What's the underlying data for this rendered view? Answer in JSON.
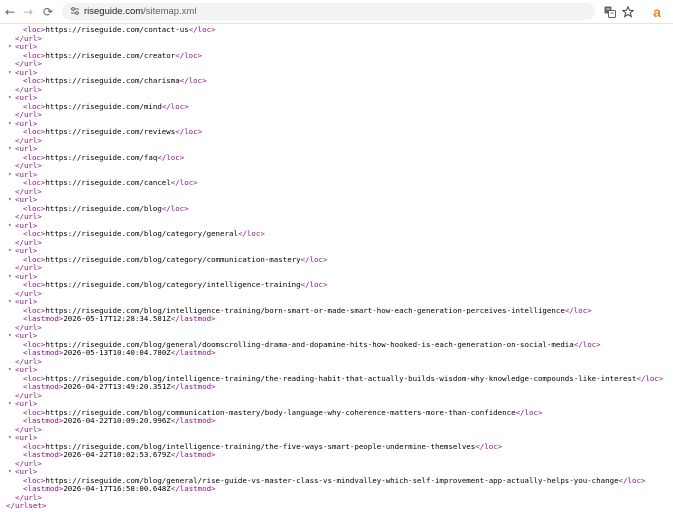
{
  "browser": {
    "back_icon": "←",
    "forward_icon": "→",
    "reload_icon": "⟳",
    "url_host": "riseguide.com",
    "url_path": "/sitemap.xml",
    "extension_letter": "a",
    "colors": {
      "tag": "#881280",
      "accent": "#f48120"
    }
  },
  "xml": {
    "collapse_arrow": "▾",
    "url_open": "<url>",
    "url_close": "</url>",
    "loc_open": "<loc>",
    "loc_close": "</loc>",
    "lastmod_open": "<lastmod>",
    "lastmod_close": "</lastmod>",
    "urlset_close": "</urlset>",
    "partial_first_loc": "https://riseguide.com/contact-us",
    "entries": [
      {
        "loc": "https://riseguide.com/creator"
      },
      {
        "loc": "https://riseguide.com/charisma"
      },
      {
        "loc": "https://riseguide.com/mind"
      },
      {
        "loc": "https://riseguide.com/reviews"
      },
      {
        "loc": "https://riseguide.com/faq"
      },
      {
        "loc": "https://riseguide.com/cancel"
      },
      {
        "loc": "https://riseguide.com/blog"
      },
      {
        "loc": "https://riseguide.com/blog/category/general"
      },
      {
        "loc": "https://riseguide.com/blog/category/communication-mastery"
      },
      {
        "loc": "https://riseguide.com/blog/category/intelligence-training"
      },
      {
        "loc": "https://riseguide.com/blog/intelligence-training/born-smart-or-made-smart-how-each-generation-perceives-intelligence",
        "lastmod": "2026-05-17T12:28:34.581Z"
      },
      {
        "loc": "https://riseguide.com/blog/general/doomscrolling-drama-and-dopamine-hits-how-hooked-is-each-generation-on-social-media",
        "lastmod": "2026-05-13T10:40:04.780Z"
      },
      {
        "loc": "https://riseguide.com/blog/intelligence-training/the-reading-habit-that-actually-builds-wisdom-why-knowledge-compounds-like-interest",
        "lastmod": "2026-04-27T13:49:20.351Z"
      },
      {
        "loc": "https://riseguide.com/blog/communication-mastery/body-language-why-coherence-matters-more-than-confidence",
        "lastmod": "2026-04-22T10:09:20.996Z"
      },
      {
        "loc": "https://riseguide.com/blog/intelligence-training/the-five-ways-smart-people-undermine-themselves",
        "lastmod": "2026-04-22T10:02:53.679Z"
      },
      {
        "loc": "https://riseguide.com/blog/general/rise-guide-vs-master-class-vs-mindvalley-which-self-improvement-app-actually-helps-you-change",
        "lastmod": "2026-04-17T16:58:00.648Z"
      }
    ]
  }
}
